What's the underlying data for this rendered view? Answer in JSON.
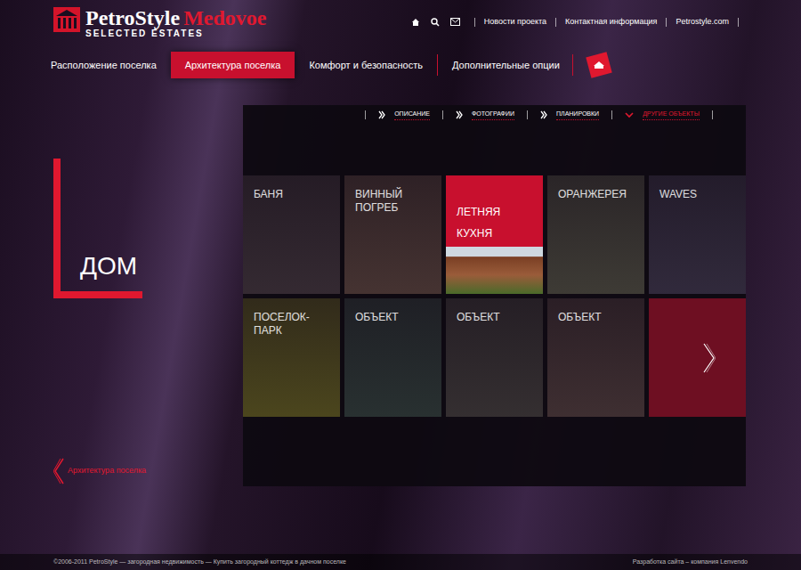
{
  "logo": {
    "name": "PetroStyle",
    "place": "Medovoe",
    "tagline": "SELECTED ESTATES"
  },
  "top_links": [
    "Новости проекта",
    "Контактная информация",
    "Petrostyle.com"
  ],
  "nav": [
    {
      "label": "Расположение поселка",
      "selected": false
    },
    {
      "label": "Архитектура поселка",
      "selected": true
    },
    {
      "label": "Комфорт и безопасность",
      "selected": false
    },
    {
      "label": "Дополнительные опции",
      "selected": false
    }
  ],
  "page": {
    "title": "ДОМ",
    "back_link": "Архитектура поселка"
  },
  "sub_tabs": [
    {
      "label": "ОПИСАНИЕ",
      "selected": false
    },
    {
      "label": "ФОТОГРАФИИ",
      "selected": false
    },
    {
      "label": "ПЛАНИРОВКИ",
      "selected": false
    },
    {
      "label": "ДРУГИЕ ОБЪЕКТЫ",
      "selected": true
    }
  ],
  "tiles": [
    {
      "label": "БАНЯ",
      "kind": "photo",
      "selected": false,
      "color": "#3a2f36"
    },
    {
      "label": "ВИННЫЙ ПОГРЕБ",
      "kind": "photo",
      "selected": false,
      "color": "#4e3a36"
    },
    {
      "label": "ЛЕТНЯЯ КУХНЯ",
      "kind": "photo",
      "selected": true,
      "color": "#8a5236"
    },
    {
      "label": "ОРАНЖЕРЕЯ",
      "kind": "photo",
      "selected": false,
      "color": "#45433a"
    },
    {
      "label": "WAVES",
      "kind": "photo",
      "selected": false,
      "color": "#362f42"
    },
    {
      "label": "ПОСЕЛОК-ПАРК",
      "kind": "photo",
      "selected": false,
      "color": "#55501e"
    },
    {
      "label": "ОБЪЕКТ",
      "kind": "photo",
      "selected": false,
      "color": "#2c3735"
    },
    {
      "label": "ОБЪЕКТ",
      "kind": "photo",
      "selected": false,
      "color": "#3a3535"
    },
    {
      "label": "ОБЪЕКТ",
      "kind": "photo",
      "selected": false,
      "color": "#463536"
    },
    {
      "label": "",
      "kind": "arrow",
      "selected": false,
      "color": "#6e0f22"
    }
  ],
  "footer": {
    "left": "©2006-2011 PetroStyle — загородная недвижимость — Купить загородный коттедж в дачном поселке",
    "right": "Разработка сайта – компания Lenvendo"
  }
}
